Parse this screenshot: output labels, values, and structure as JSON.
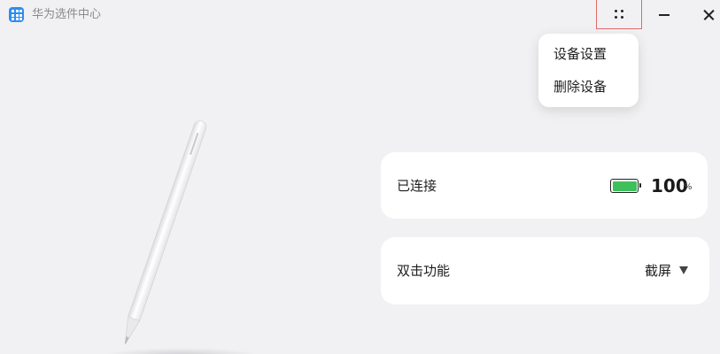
{
  "window": {
    "title": "华为选件中心",
    "controls": {
      "more_icon": "more-dots-icon",
      "minimize_icon": "minimize-icon",
      "close_icon": "close-icon"
    }
  },
  "menu": {
    "items": [
      {
        "label": "设备设置"
      },
      {
        "label": "删除设备"
      }
    ]
  },
  "device": {
    "connection": {
      "status_label": "已连接",
      "battery_level": "100",
      "battery_unit": "%",
      "battery_fraction": 1.0,
      "battery_color": "#3dc05c"
    },
    "double_tap": {
      "label": "双击功能",
      "selected_value": "截屏"
    }
  },
  "colors": {
    "accent": "#2f8cf0",
    "highlight_border": "#e06b6b"
  }
}
